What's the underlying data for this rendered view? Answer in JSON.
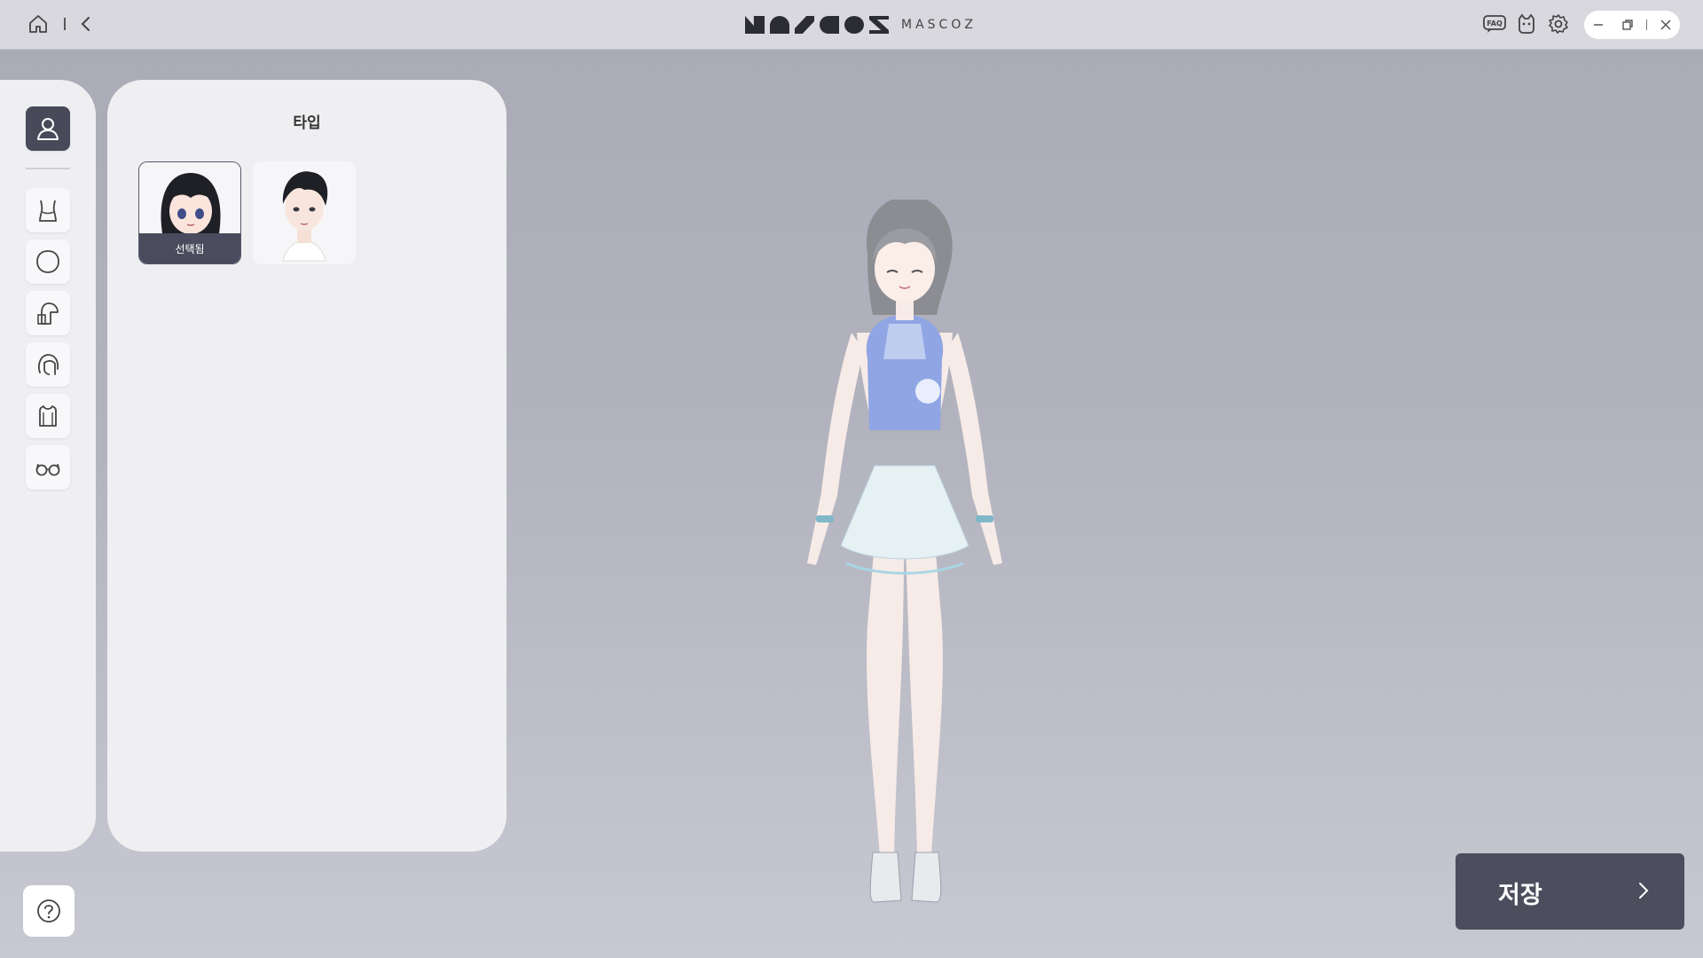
{
  "titlebar": {
    "logo_text": "MASCOZ",
    "left_icons": [
      "home-icon",
      "back-icon"
    ],
    "right_icons": [
      "faq-icon",
      "mascot-icon",
      "gear-icon"
    ],
    "faq_badge": "FAQ",
    "window_controls": [
      "minimize-icon",
      "restore-icon",
      "close-icon"
    ]
  },
  "rail": {
    "items": [
      {
        "icon": "person-icon",
        "active": true
      },
      {
        "icon": "body-icon",
        "active": false
      },
      {
        "icon": "face-shape-icon",
        "active": false
      },
      {
        "icon": "skin-icon",
        "active": false
      },
      {
        "icon": "hair-icon",
        "active": false
      },
      {
        "icon": "clothing-icon",
        "active": false
      },
      {
        "icon": "glasses-icon",
        "active": false
      }
    ]
  },
  "panel": {
    "title": "타입",
    "options": [
      {
        "name": "female-type",
        "selected": true,
        "label": "선택됨"
      },
      {
        "name": "male-type",
        "selected": false,
        "label": ""
      }
    ]
  },
  "help": {
    "icon": "help-icon"
  },
  "save": {
    "label": "저장",
    "icon": "chevron-right-icon"
  },
  "colors": {
    "accent": "#484a5a",
    "panel": "#efeff2",
    "background": "#b2b3be"
  }
}
